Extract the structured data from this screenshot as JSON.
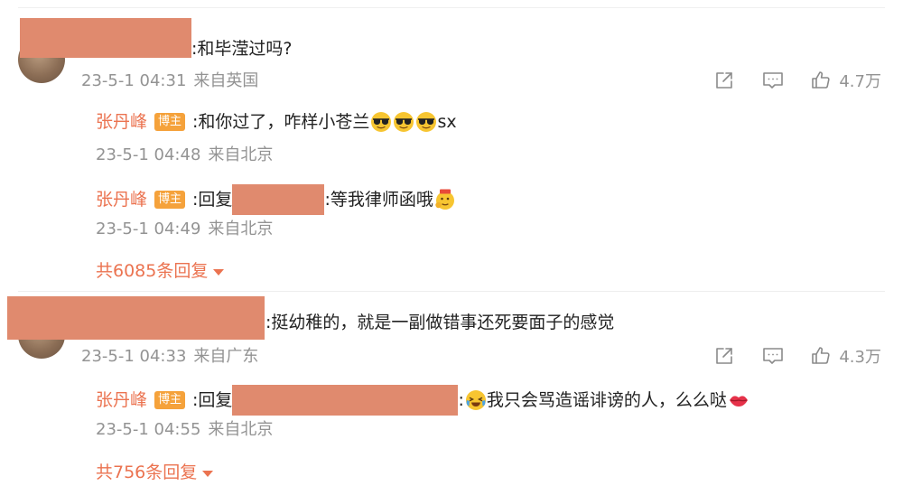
{
  "comments": [
    {
      "text": ":和毕滢过吗?",
      "time": "23-5-1 04:31",
      "location": "来自英国",
      "likes": "4.7万",
      "replies": [
        {
          "author": "张丹峰",
          "badge": "博主",
          "text_before": ":和你过了，咋样小苍兰",
          "text_after": "sx",
          "time": "23-5-1 04:48",
          "location": "来自北京"
        },
        {
          "author": "张丹峰",
          "badge": "博主",
          "prefix": ":回复",
          "text": ":等我律师函哦",
          "time": "23-5-1 04:49",
          "location": "来自北京"
        }
      ],
      "more": "共6085条回复"
    },
    {
      "text": ":挺幼稚的，就是一副做错事还死要面子的感觉",
      "time": "23-5-1 04:33",
      "location": "来自广东",
      "likes": "4.3万",
      "replies": [
        {
          "author": "张丹峰",
          "badge": "博主",
          "prefix": ":回复",
          "text": "我只会骂造谣诽谤的人，么么哒",
          "time": "23-5-1 04:55",
          "location": "来自北京"
        }
      ],
      "more": "共756条回复"
    }
  ],
  "icons": {
    "share": "share-icon",
    "comment": "comment-icon",
    "like": "like-icon",
    "sunglasses": "sunglasses-emoji",
    "laugh_cry": "laugh-cry-emoji",
    "kiss": "kiss-lips-emoji"
  },
  "colors": {
    "username": "#eb7350",
    "badge": "#f5a23b",
    "redaction": "#e08a6e",
    "meta": "#939393"
  }
}
